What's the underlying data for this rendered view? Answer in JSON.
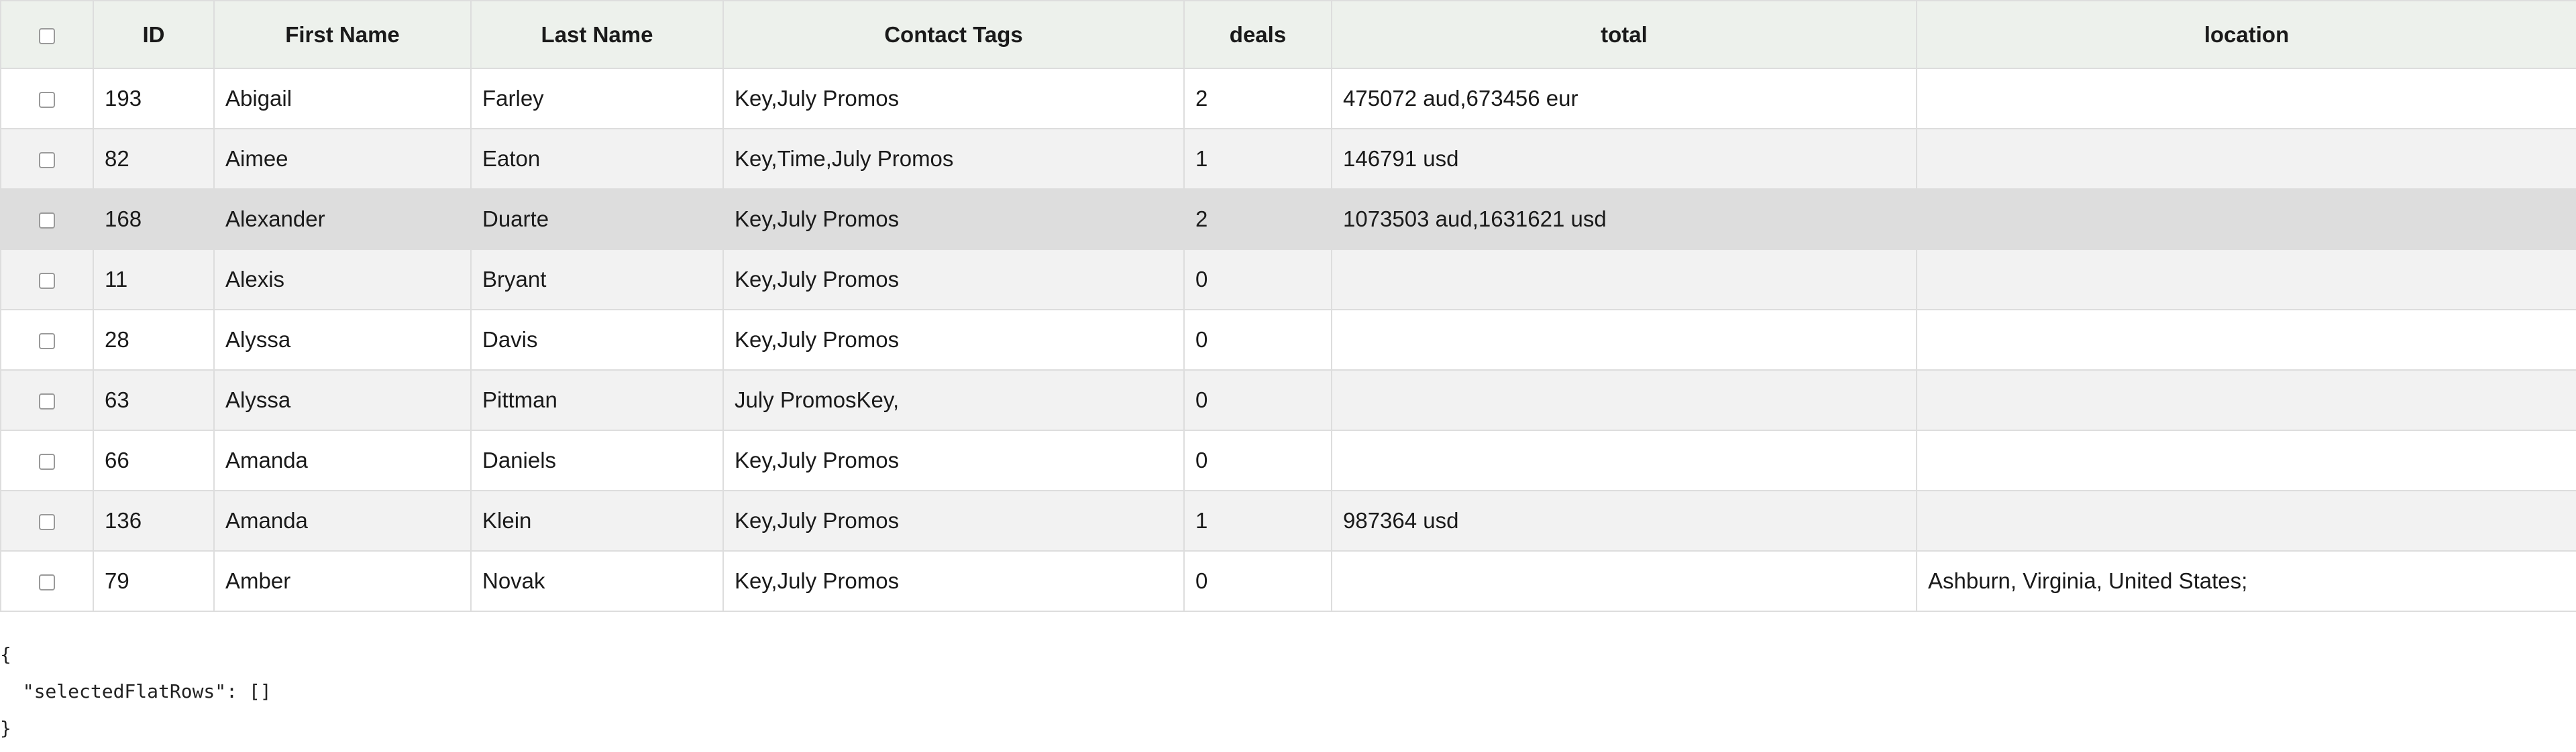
{
  "table": {
    "headers": {
      "id": "ID",
      "first_name": "First Name",
      "last_name": "Last Name",
      "contact_tags": "Contact Tags",
      "deals": "deals",
      "total": "total",
      "location": "location"
    },
    "rows": [
      {
        "id": "193",
        "first_name": "Abigail",
        "last_name": "Farley",
        "contact_tags": "Key,July Promos",
        "deals": "2",
        "total": "475072 aud,673456 eur",
        "location": "",
        "checked": false
      },
      {
        "id": "82",
        "first_name": "Aimee",
        "last_name": "Eaton",
        "contact_tags": "Key,Time,July Promos",
        "deals": "1",
        "total": "146791 usd",
        "location": "",
        "checked": false
      },
      {
        "id": "168",
        "first_name": "Alexander",
        "last_name": "Duarte",
        "contact_tags": "Key,July Promos",
        "deals": "2",
        "total": "1073503 aud,1631621 usd",
        "location": "",
        "checked": false
      },
      {
        "id": "11",
        "first_name": "Alexis",
        "last_name": "Bryant",
        "contact_tags": "Key,July Promos",
        "deals": "0",
        "total": "",
        "location": "",
        "checked": false
      },
      {
        "id": "28",
        "first_name": "Alyssa",
        "last_name": "Davis",
        "contact_tags": "Key,July Promos",
        "deals": "0",
        "total": "",
        "location": "",
        "checked": false
      },
      {
        "id": "63",
        "first_name": "Alyssa",
        "last_name": "Pittman",
        "contact_tags": "July PromosKey,",
        "deals": "0",
        "total": "",
        "location": "",
        "checked": false
      },
      {
        "id": "66",
        "first_name": "Amanda",
        "last_name": "Daniels",
        "contact_tags": "Key,July Promos",
        "deals": "0",
        "total": "",
        "location": "",
        "checked": false
      },
      {
        "id": "136",
        "first_name": "Amanda",
        "last_name": "Klein",
        "contact_tags": "Key,July Promos",
        "deals": "1",
        "total": "987364 usd",
        "location": "",
        "checked": false
      },
      {
        "id": "79",
        "first_name": "Amber",
        "last_name": "Novak",
        "contact_tags": "Key,July Promos",
        "deals": "0",
        "total": "",
        "location": "Ashburn, Virginia, United States;",
        "checked": false
      }
    ]
  },
  "state_output": {
    "line1": "{",
    "line2": "  \"selectedFlatRows\": []",
    "line3": "}"
  },
  "colors": {
    "header_bg": "#edf1ec",
    "row_even": "#ffffff",
    "row_odd": "#f2f2f2",
    "row_hover": "#dddddd",
    "border": "#dddddd"
  }
}
